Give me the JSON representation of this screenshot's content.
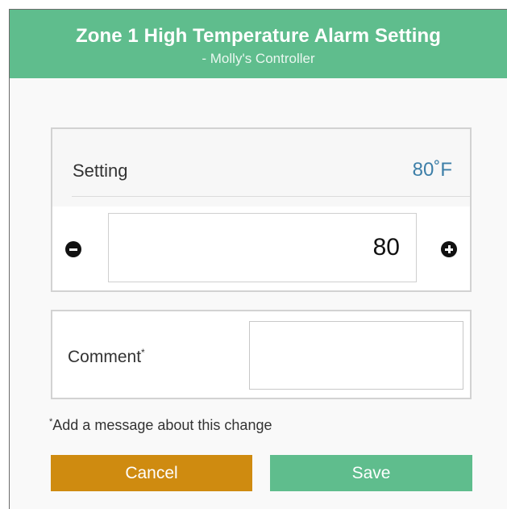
{
  "header": {
    "title": "Zone 1 High Temperature Alarm Setting",
    "subtitle": "- Molly's Controller"
  },
  "setting": {
    "label": "Setting",
    "current_display": "80˚F",
    "input_value": "80"
  },
  "comment": {
    "label": "Comment",
    "required_marker": "*",
    "value": ""
  },
  "footnote": {
    "marker": "*",
    "text": "Add a message about this change"
  },
  "buttons": {
    "cancel_label": "Cancel",
    "save_label": "Save"
  },
  "colors": {
    "header_green": "#5fbd8d",
    "save_green": "#5fbd8d",
    "cancel_amber": "#cf8b10",
    "value_blue": "#3d7fa8"
  },
  "icons": {
    "decrement": "minus-circle-icon",
    "increment": "plus-circle-icon"
  }
}
